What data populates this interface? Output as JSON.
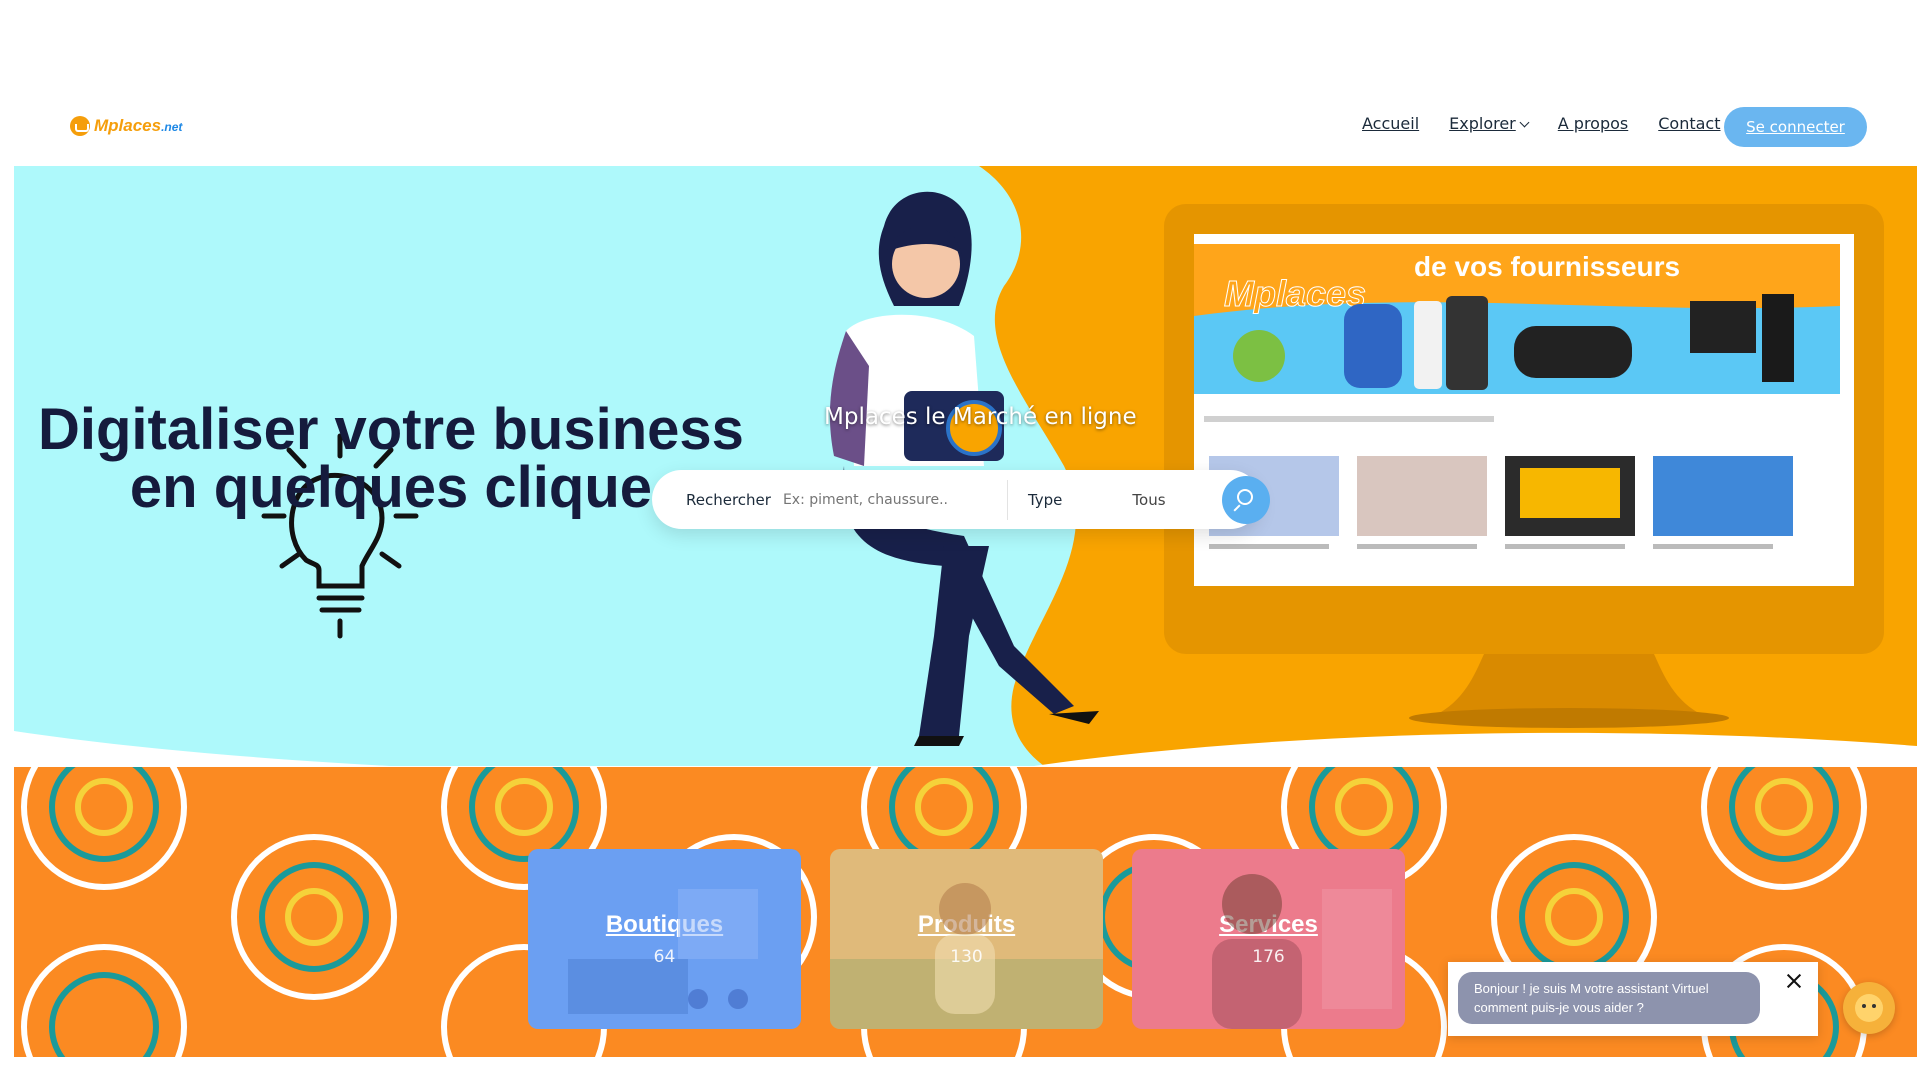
{
  "brand": {
    "name": "Mplaces",
    "suffix": ".net"
  },
  "nav": {
    "home": "Accueil",
    "explore": "Explorer",
    "about": "A propos",
    "contact": "Contact",
    "login": "Se connecter"
  },
  "hero": {
    "headline_line1": "Digitaliser votre business",
    "headline_line2": "en quelques clique",
    "tagline": "Mplaces le Marché en ligne"
  },
  "search": {
    "label": "Rechercher",
    "placeholder": "Ex: piment, chaussure..",
    "type_label": "Type",
    "type_value": "Tous"
  },
  "categories": [
    {
      "title": "Boutiques",
      "count": "64"
    },
    {
      "title": "Produits",
      "count": "130"
    },
    {
      "title": "Services",
      "count": "176"
    }
  ],
  "chat": {
    "message": "Bonjour ! je suis M votre assistant Virtuel comment puis-je vous aider ?"
  },
  "colors": {
    "accent": "#6ab6f0",
    "hero_cyan": "#aef9fb",
    "hero_orange": "#f9a400",
    "navy": "#151b3d"
  }
}
